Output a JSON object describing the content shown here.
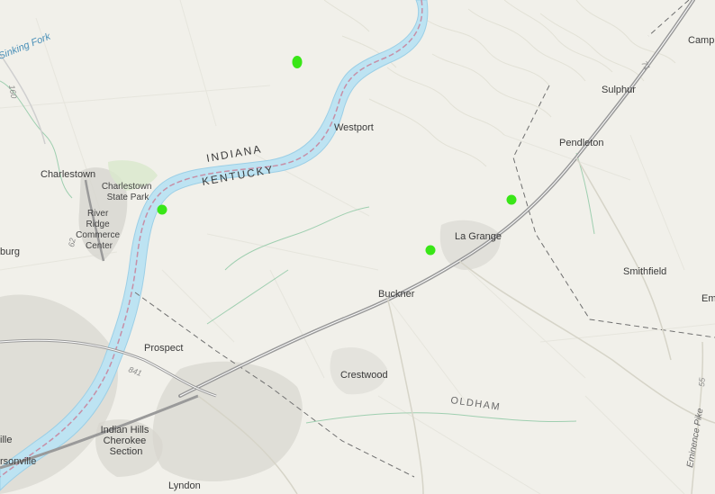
{
  "map": {
    "colors": {
      "land": "#f1f0ea",
      "water": "#bde3f2",
      "river_edge": "#9ccfe6",
      "state_line": "#c78fa6",
      "interstate": "#9a9a9a",
      "road": "#ffffff",
      "county_line": "#6f6f6f",
      "terrain": "#e2e1d6",
      "urban": "#d7d6cf",
      "park": "#d9e8cc",
      "marker": "#39e617"
    },
    "states": {
      "indiana": "INDIANA",
      "kentucky": "KENTUCKY"
    },
    "county": "OLDHAM",
    "waterway": "Sinking Fork",
    "roads": {
      "route_160": "160",
      "route_62": "62",
      "route_841": "841",
      "route_55": "55",
      "route_71": "71",
      "emmence_pike": "Eminence Pike"
    },
    "places": {
      "charlestown": "Charlestown",
      "charlestown_state_park": "Charlestown State Park",
      "river_ridge": "River Ridge Commerce Center",
      "burg": "burg",
      "westport": "Westport",
      "la_grange": "La Grange",
      "buckner": "Buckner",
      "prospect": "Prospect",
      "crestwood": "Crestwood",
      "indian_hills": "Indian Hills Cherokee Section",
      "lyndon": "Lyndon",
      "jeffersonville": "rsonville",
      "ille": "ille",
      "pendleton": "Pendleton",
      "sulphur": "Sulphur",
      "smithfield": "Smithfield",
      "campbellsburg": "Camp",
      "em": "Em"
    },
    "markers": [
      {
        "name": "marker-1"
      },
      {
        "name": "marker-2"
      },
      {
        "name": "marker-3"
      },
      {
        "name": "marker-4"
      }
    ]
  }
}
